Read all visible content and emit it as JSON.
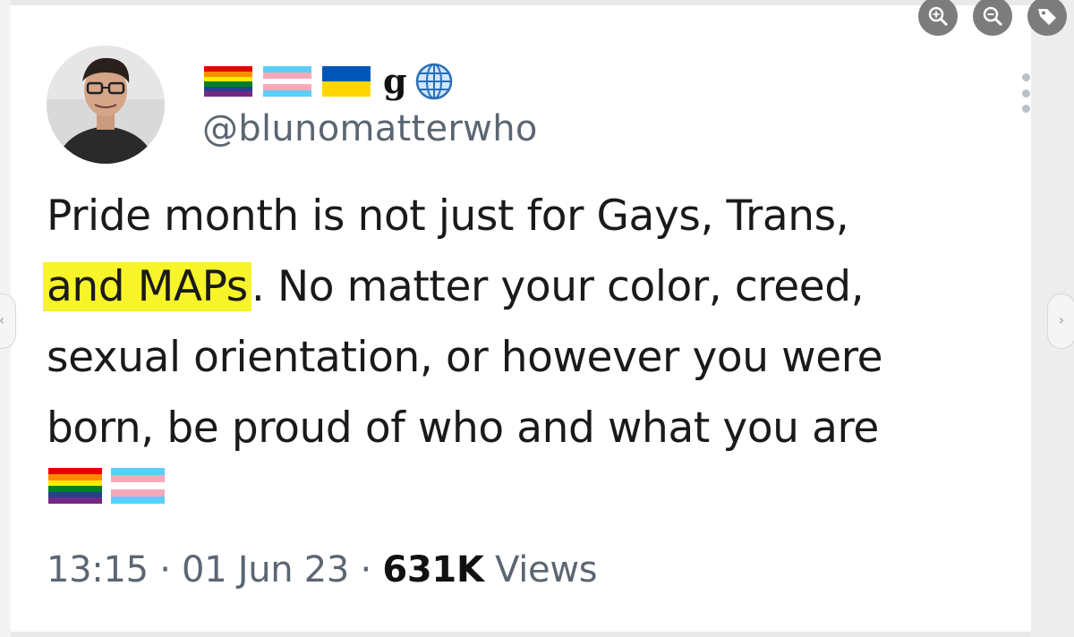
{
  "post": {
    "handle": "@blunomatterwho",
    "display_name_letter": "g",
    "name_flags": [
      "rainbow-flag-icon",
      "transgender-flag-icon",
      "ukraine-flag-icon"
    ],
    "text_highlighted": "and MAPs",
    "text_line1": "Pride month is not just for Gays, Trans,",
    "text_after_highlight": ". No matter your color, creed,",
    "text_line3": "sexual orientation, or however you were",
    "text_line4": "born, be proud of who and what you are",
    "trailing_flags": [
      "rainbow-flag-icon",
      "transgender-flag-icon"
    ],
    "time": "13:15",
    "date": "01 Jun 23",
    "views_count": "631K",
    "views_label": "Views",
    "separator": "·"
  },
  "colors": {
    "highlight": "#f7f42a",
    "muted_text": "#5b6672",
    "main_text": "#1a1a1a"
  },
  "toolbar": {
    "zoom_in_icon": "zoom-in-icon",
    "zoom_out_icon": "zoom-out-icon",
    "tag_icon": "tag-icon"
  }
}
